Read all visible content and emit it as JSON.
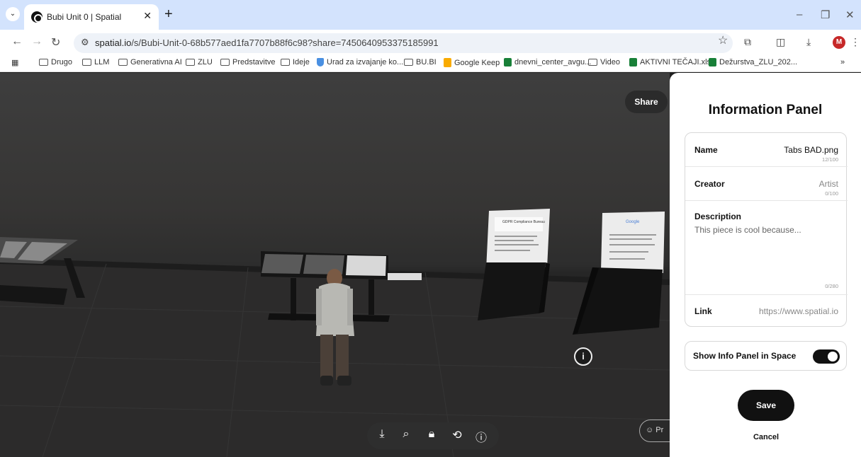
{
  "browser": {
    "tab_title": "Bubi Unit 0 | Spatial",
    "url_host": "spatial.io",
    "url_path": "/s/Bubi-Unit-0-68b577aed1fa7707b88f6c98?share=7450640953375185991",
    "profile_initial": "M"
  },
  "bookmarks": [
    {
      "label": "Drugo",
      "icon": "folder-icon"
    },
    {
      "label": "LLM",
      "icon": "folder-icon"
    },
    {
      "label": "Generativna AI",
      "icon": "folder-icon"
    },
    {
      "label": "ZLU",
      "icon": "folder-icon"
    },
    {
      "label": "Predstavitve",
      "icon": "folder-icon"
    },
    {
      "label": "Ideje",
      "icon": "folder-icon"
    },
    {
      "label": "Urad za izvajanje ko...",
      "icon": "shield-icon"
    },
    {
      "label": "BU.BI",
      "icon": "folder-icon"
    },
    {
      "label": "Google Keep",
      "icon": "keep-icon"
    },
    {
      "label": "dnevni_center_avgu...",
      "icon": "sheets-icon"
    },
    {
      "label": "Video",
      "icon": "folder-icon"
    },
    {
      "label": "AKTIVNI TEČAJI.xlsx",
      "icon": "sheets-icon"
    },
    {
      "label": "Dežurstva_ZLU_202...",
      "icon": "sheets-icon"
    }
  ],
  "scene": {
    "share_label": "Share",
    "profile_pill_label": "Pr",
    "poster_left_title": "GDPR Compliance Bureau",
    "poster_right_title": "Google"
  },
  "panel": {
    "title": "Information Panel",
    "name_label": "Name",
    "name_value": "Tabs BAD.png",
    "name_count": "12/100",
    "creator_label": "Creator",
    "creator_value": "Artist",
    "creator_count": "0/100",
    "description_label": "Description",
    "description_placeholder": "This piece is cool because...",
    "description_count": "0/280",
    "link_label": "Link",
    "link_value": "https://www.spatial.io",
    "toggle_label": "Show Info Panel in Space",
    "toggle_on": true,
    "save_label": "Save",
    "cancel_label": "Cancel"
  }
}
